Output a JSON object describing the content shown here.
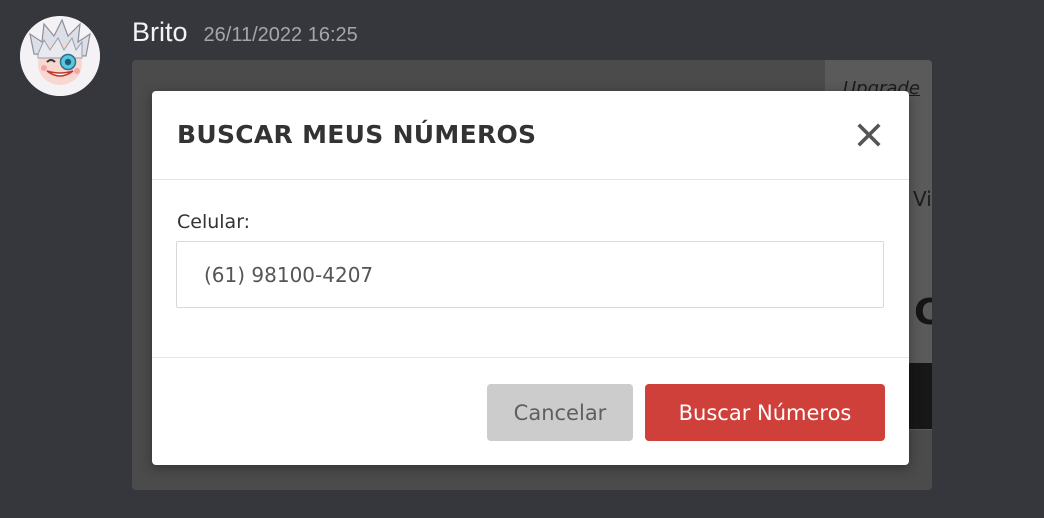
{
  "message": {
    "username": "Brito",
    "timestamp": "26/11/2022 16:25",
    "avatar_icon": "anime-avatar-icon"
  },
  "background_page": {
    "upgrade_fragment": "Upgrade",
    "vi_fragment": "Vi",
    "c_fragment": "C"
  },
  "modal": {
    "title": "BUSCAR MEUS NÚMEROS",
    "close_icon": "close-icon",
    "field_label": "Celular:",
    "phone_value": "(61) 98100-4207",
    "cancel_label": "Cancelar",
    "search_label": "Buscar Números"
  },
  "colors": {
    "app_background": "#36373d",
    "primary_button": "#d0403b",
    "secondary_button": "#cccccc"
  }
}
